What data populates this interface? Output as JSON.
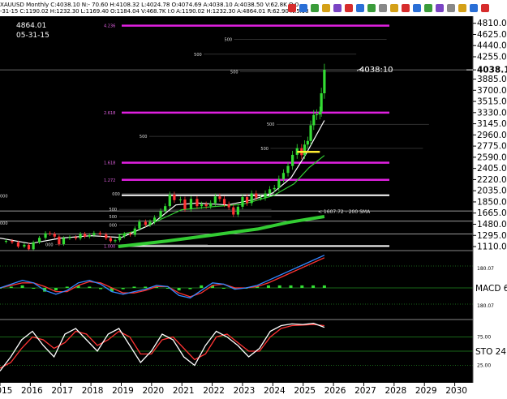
{
  "header": {
    "symbol_line": "XAUUSD Monthly C:4038.10 N:- 70.60 H:4108.32 L:4024.78 O:4074.69 A:4038.10 A:4038.50 V:62.8K O:0",
    "ohlc_line": "-31-15 C:1190.02 H:1232.30 L:1169.40 O:1184.04 V:468.7K I:0 A:1190.02 H:1232.30 A:4864.01 R:62.90 N:5.98",
    "toolbar_icons": [
      "layout-icon",
      "zoom-icon",
      "cursor-icon",
      "draw-icon",
      "text-icon",
      "fib-icon",
      "home-icon",
      "chart-type-icon",
      "indicator-icon",
      "template-icon",
      "color-icon",
      "settings-icon",
      "crosshair-icon",
      "scale-icon",
      "fit-icon",
      "tile-icon",
      "window-icon",
      "close-icon"
    ],
    "toolbar_colors": [
      "#d62c2c",
      "#2a6fd6",
      "#3a9c3a",
      "#d4a017",
      "#7a44c4",
      "#d62c2c",
      "#2a6fd6",
      "#3a9c3a",
      "#888888",
      "#d4a017",
      "#d62c2c",
      "#2a6fd6",
      "#3a9c3a",
      "#7a44c4",
      "#888888",
      "#d4a017",
      "#2a6fd6",
      "#d62c2c"
    ]
  },
  "readout": {
    "price": "4864.01",
    "date": "05-31-15"
  },
  "chart_data": {
    "type": "candlestick",
    "x_ticks": [
      "2015",
      "2016",
      "2017",
      "2018",
      "2019",
      "2020",
      "2021",
      "2022",
      "2023",
      "2024",
      "2025",
      "2026",
      "2027",
      "2028",
      "2029",
      "2030"
    ],
    "x_range": [
      2015.0,
      2030.6
    ],
    "y_ticks": [
      4810.0,
      4625.0,
      4440.0,
      4255.0,
      4038.1,
      3885.0,
      3700.0,
      3515.0,
      3330.0,
      3145.0,
      2960.0,
      2775.0,
      2590.0,
      2405.0,
      2220.0,
      2035.0,
      1850.0,
      1665.0,
      1480.0,
      1295.0,
      1110.0
    ],
    "y_range": [
      1070,
      4900
    ],
    "last_price_label": "4038.10",
    "annotation_price": "4038:10",
    "sma_label": "<  1607.72 - 200 SMA",
    "fib_labels": [
      {
        "text": "4.236",
        "y": 4770
      },
      {
        "text": "2.618",
        "y": 3330
      },
      {
        "text": "1.618",
        "y": 2500
      },
      {
        "text": "1.272",
        "y": 2215
      },
      {
        "text": "1.000",
        "y": 1118
      }
    ],
    "fib_magenta_levels": [
      4770,
      3330,
      2500,
      2215
    ],
    "white_support_levels": [
      1960,
      1118
    ],
    "thin_grey_levels": [
      1700,
      1530,
      1320
    ],
    "left_edge_labels": [
      {
        "text": "000",
        "y": 1950
      },
      {
        "text": "000",
        "y": 1500
      }
    ],
    "round_markers": [
      {
        "text": "500",
        "x": 2022.4,
        "y": 4520
      },
      {
        "text": "500",
        "x": 2021.4,
        "y": 4270
      },
      {
        "text": "500",
        "x": 2022.6,
        "y": 3980
      },
      {
        "text": "500",
        "x": 2023.8,
        "y": 3110
      },
      {
        "text": "500",
        "x": 2019.6,
        "y": 2910
      },
      {
        "text": "500",
        "x": 2023.6,
        "y": 2710
      },
      {
        "text": "000",
        "x": 2018.7,
        "y": 1960
      },
      {
        "text": "500",
        "x": 2018.6,
        "y": 1700
      },
      {
        "text": "500",
        "x": 2018.6,
        "y": 1580
      },
      {
        "text": "000",
        "x": 2018.6,
        "y": 1440
      },
      {
        "text": "000",
        "x": 2016.5,
        "y": 1118
      }
    ],
    "monthly_close": [
      [
        2015.0,
        1190
      ],
      [
        2015.2,
        1205
      ],
      [
        2015.4,
        1180
      ],
      [
        2015.6,
        1110
      ],
      [
        2015.8,
        1140
      ],
      [
        2015.95,
        1065
      ],
      [
        2016.1,
        1180
      ],
      [
        2016.3,
        1255
      ],
      [
        2016.5,
        1330
      ],
      [
        2016.65,
        1320
      ],
      [
        2016.8,
        1275
      ],
      [
        2016.95,
        1150
      ],
      [
        2017.1,
        1250
      ],
      [
        2017.3,
        1265
      ],
      [
        2017.5,
        1245
      ],
      [
        2017.65,
        1320
      ],
      [
        2017.8,
        1275
      ],
      [
        2017.95,
        1300
      ],
      [
        2018.1,
        1335
      ],
      [
        2018.3,
        1310
      ],
      [
        2018.5,
        1250
      ],
      [
        2018.65,
        1200
      ],
      [
        2018.8,
        1215
      ],
      [
        2018.95,
        1280
      ],
      [
        2019.1,
        1320
      ],
      [
        2019.3,
        1305
      ],
      [
        2019.45,
        1410
      ],
      [
        2019.6,
        1520
      ],
      [
        2019.8,
        1470
      ],
      [
        2019.95,
        1520
      ],
      [
        2020.1,
        1590
      ],
      [
        2020.3,
        1700
      ],
      [
        2020.45,
        1780
      ],
      [
        2020.6,
        1970
      ],
      [
        2020.75,
        1880
      ],
      [
        2020.95,
        1890
      ],
      [
        2021.1,
        1730
      ],
      [
        2021.3,
        1900
      ],
      [
        2021.5,
        1780
      ],
      [
        2021.65,
        1810
      ],
      [
        2021.8,
        1780
      ],
      [
        2021.95,
        1830
      ],
      [
        2022.1,
        1940
      ],
      [
        2022.25,
        1900
      ],
      [
        2022.4,
        1810
      ],
      [
        2022.55,
        1760
      ],
      [
        2022.7,
        1640
      ],
      [
        2022.85,
        1770
      ],
      [
        2023.0,
        1930
      ],
      [
        2023.15,
        1830
      ],
      [
        2023.3,
        1990
      ],
      [
        2023.45,
        1920
      ],
      [
        2023.6,
        1920
      ],
      [
        2023.75,
        1990
      ],
      [
        2023.9,
        2060
      ],
      [
        2024.05,
        2080
      ],
      [
        2024.2,
        2230
      ],
      [
        2024.35,
        2330
      ],
      [
        2024.5,
        2445
      ],
      [
        2024.65,
        2630
      ],
      [
        2024.8,
        2740
      ],
      [
        2024.95,
        2625
      ],
      [
        2025.05,
        2800
      ],
      [
        2025.15,
        2860
      ],
      [
        2025.25,
        3120
      ],
      [
        2025.35,
        3290
      ],
      [
        2025.45,
        3300
      ],
      [
        2025.55,
        3345
      ],
      [
        2025.6,
        3650
      ],
      [
        2025.7,
        4038
      ]
    ],
    "sma_fast": [
      [
        2015.0,
        1250
      ],
      [
        2016.0,
        1160
      ],
      [
        2017.0,
        1250
      ],
      [
        2018.0,
        1290
      ],
      [
        2019.0,
        1260
      ],
      [
        2020.0,
        1480
      ],
      [
        2020.8,
        1800
      ],
      [
        2021.5,
        1830
      ],
      [
        2022.5,
        1800
      ],
      [
        2023.3,
        1880
      ],
      [
        2024.0,
        2000
      ],
      [
        2024.6,
        2250
      ],
      [
        2025.1,
        2650
      ],
      [
        2025.7,
        3200
      ]
    ],
    "sma_mid": [
      [
        2018.9,
        1300
      ],
      [
        2019.5,
        1370
      ],
      [
        2020.3,
        1560
      ],
      [
        2021.0,
        1720
      ],
      [
        2022.0,
        1770
      ],
      [
        2023.0,
        1810
      ],
      [
        2024.0,
        1950
      ],
      [
        2024.7,
        2150
      ],
      [
        2025.2,
        2420
      ],
      [
        2025.7,
        2620
      ]
    ],
    "sma_200": [
      [
        2018.9,
        1110
      ],
      [
        2020.5,
        1200
      ],
      [
        2022.0,
        1300
      ],
      [
        2023.5,
        1400
      ],
      [
        2024.5,
        1510
      ],
      [
        2025.7,
        1607.72
      ]
    ],
    "yellow_marker": {
      "x1": 2024.8,
      "x2": 2025.55,
      "y": 2680
    },
    "macd": {
      "label": "MACD 6",
      "ticks": [
        "180.07",
        "180.07"
      ],
      "zero_label": "",
      "series_blue": [
        0,
        3,
        6,
        4,
        -2,
        -5,
        -2,
        4,
        6,
        3,
        -3,
        -5,
        -3,
        -1,
        2,
        1,
        -6,
        -8,
        -2,
        4,
        3,
        -1,
        0,
        2,
        6,
        10,
        14,
        18,
        22,
        26
      ],
      "series_red": [
        0,
        2,
        4,
        4,
        1,
        -3,
        -3,
        2,
        5,
        4,
        0,
        -4,
        -4,
        -2,
        1,
        1,
        -4,
        -7,
        -4,
        2,
        3,
        0,
        0,
        1,
        4,
        8,
        12,
        16,
        20,
        24
      ],
      "hist": [
        0,
        1,
        2,
        0,
        -3,
        -2,
        1,
        2,
        1,
        -1,
        -3,
        -1,
        1,
        1,
        1,
        0,
        -2,
        -1,
        2,
        2,
        0,
        -1,
        0,
        1,
        2,
        2,
        2,
        2,
        2,
        2
      ]
    },
    "stoch": {
      "label": "STO 24",
      "levels": [
        "75.00",
        "25.00"
      ],
      "k": [
        15,
        40,
        70,
        85,
        60,
        40,
        80,
        90,
        70,
        50,
        80,
        90,
        60,
        30,
        50,
        80,
        70,
        40,
        25,
        60,
        85,
        75,
        60,
        40,
        55,
        85,
        95,
        98,
        97,
        99,
        92
      ],
      "d": [
        20,
        30,
        55,
        75,
        70,
        55,
        65,
        85,
        80,
        60,
        70,
        85,
        75,
        45,
        45,
        70,
        75,
        55,
        35,
        45,
        75,
        80,
        65,
        50,
        50,
        75,
        90,
        95,
        96,
        97,
        95
      ]
    }
  }
}
